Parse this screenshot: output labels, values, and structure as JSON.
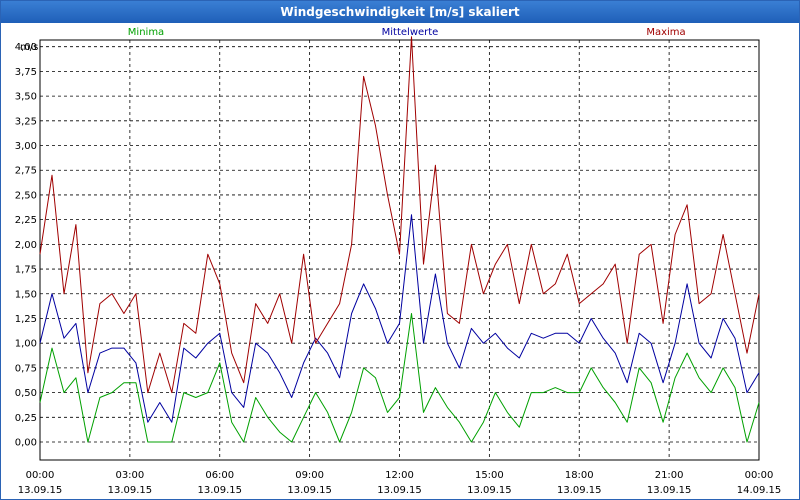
{
  "window": {
    "title": "Windgeschwindigkeit [m/s] skaliert"
  },
  "chart_data": {
    "type": "line",
    "title": "Windgeschwindigkeit [m/s] skaliert",
    "ylabel": "m/s",
    "ylim": [
      0,
      4.25
    ],
    "y_ticks": [
      "0,00",
      "0,25",
      "0,50",
      "0,75",
      "1,00",
      "1,25",
      "1,50",
      "1,75",
      "2,00",
      "2,25",
      "2,50",
      "2,75",
      "3,00",
      "3,25",
      "3,50",
      "3,75",
      "4,00"
    ],
    "x_ticks": [
      {
        "time": "00:00",
        "date": "13.09.15"
      },
      {
        "time": "03:00",
        "date": "13.09.15"
      },
      {
        "time": "06:00",
        "date": "13.09.15"
      },
      {
        "time": "09:00",
        "date": "13.09.15"
      },
      {
        "time": "12:00",
        "date": "13.09.15"
      },
      {
        "time": "15:00",
        "date": "13.09.15"
      },
      {
        "time": "18:00",
        "date": "13.09.15"
      },
      {
        "time": "21:00",
        "date": "13.09.15"
      },
      {
        "time": "00:00",
        "date": "14.09.15"
      }
    ],
    "x_range_hours": [
      0,
      24
    ],
    "grid": true,
    "legend_position": "top",
    "series": [
      {
        "name": "Minima",
        "color": "#00a000",
        "values": [
          [
            0,
            0.4
          ],
          [
            0.4,
            0.95
          ],
          [
            0.8,
            0.5
          ],
          [
            1.2,
            0.65
          ],
          [
            1.6,
            0.0
          ],
          [
            2.0,
            0.45
          ],
          [
            2.4,
            0.5
          ],
          [
            2.8,
            0.6
          ],
          [
            3.2,
            0.6
          ],
          [
            3.6,
            0.0
          ],
          [
            4.0,
            0.0
          ],
          [
            4.4,
            0.0
          ],
          [
            4.8,
            0.5
          ],
          [
            5.2,
            0.45
          ],
          [
            5.6,
            0.5
          ],
          [
            6.0,
            0.8
          ],
          [
            6.4,
            0.2
          ],
          [
            6.8,
            0.0
          ],
          [
            7.2,
            0.45
          ],
          [
            7.6,
            0.25
          ],
          [
            8.0,
            0.1
          ],
          [
            8.4,
            0.0
          ],
          [
            8.8,
            0.25
          ],
          [
            9.2,
            0.5
          ],
          [
            9.6,
            0.3
          ],
          [
            10.0,
            0.0
          ],
          [
            10.4,
            0.3
          ],
          [
            10.8,
            0.75
          ],
          [
            11.2,
            0.65
          ],
          [
            11.6,
            0.3
          ],
          [
            12.0,
            0.45
          ],
          [
            12.4,
            1.3
          ],
          [
            12.8,
            0.3
          ],
          [
            13.2,
            0.55
          ],
          [
            13.6,
            0.35
          ],
          [
            14.0,
            0.2
          ],
          [
            14.4,
            0.0
          ],
          [
            14.8,
            0.2
          ],
          [
            15.2,
            0.5
          ],
          [
            15.6,
            0.3
          ],
          [
            16.0,
            0.15
          ],
          [
            16.4,
            0.5
          ],
          [
            16.8,
            0.5
          ],
          [
            17.2,
            0.55
          ],
          [
            17.6,
            0.5
          ],
          [
            18.0,
            0.5
          ],
          [
            18.4,
            0.75
          ],
          [
            18.8,
            0.55
          ],
          [
            19.2,
            0.4
          ],
          [
            19.6,
            0.2
          ],
          [
            20.0,
            0.75
          ],
          [
            20.4,
            0.6
          ],
          [
            20.8,
            0.2
          ],
          [
            21.2,
            0.65
          ],
          [
            21.6,
            0.9
          ],
          [
            22.0,
            0.65
          ],
          [
            22.4,
            0.5
          ],
          [
            22.8,
            0.75
          ],
          [
            23.2,
            0.55
          ],
          [
            23.6,
            0.0
          ],
          [
            24.0,
            0.4
          ]
        ]
      },
      {
        "name": "Mittelwerte",
        "color": "#0000a0",
        "values": [
          [
            0,
            1.0
          ],
          [
            0.4,
            1.5
          ],
          [
            0.8,
            1.05
          ],
          [
            1.2,
            1.2
          ],
          [
            1.6,
            0.5
          ],
          [
            2.0,
            0.9
          ],
          [
            2.4,
            0.95
          ],
          [
            2.8,
            0.95
          ],
          [
            3.2,
            0.8
          ],
          [
            3.6,
            0.2
          ],
          [
            4.0,
            0.4
          ],
          [
            4.4,
            0.2
          ],
          [
            4.8,
            0.95
          ],
          [
            5.2,
            0.85
          ],
          [
            5.6,
            1.0
          ],
          [
            6.0,
            1.1
          ],
          [
            6.4,
            0.5
          ],
          [
            6.8,
            0.35
          ],
          [
            7.2,
            1.0
          ],
          [
            7.6,
            0.9
          ],
          [
            8.0,
            0.7
          ],
          [
            8.4,
            0.45
          ],
          [
            8.8,
            0.8
          ],
          [
            9.2,
            1.05
          ],
          [
            9.6,
            0.9
          ],
          [
            10.0,
            0.65
          ],
          [
            10.4,
            1.3
          ],
          [
            10.8,
            1.6
          ],
          [
            11.2,
            1.35
          ],
          [
            11.6,
            1.0
          ],
          [
            12.0,
            1.2
          ],
          [
            12.4,
            2.3
          ],
          [
            12.8,
            1.0
          ],
          [
            13.2,
            1.7
          ],
          [
            13.6,
            1.0
          ],
          [
            14.0,
            0.75
          ],
          [
            14.4,
            1.15
          ],
          [
            14.8,
            1.0
          ],
          [
            15.2,
            1.1
          ],
          [
            15.6,
            0.95
          ],
          [
            16.0,
            0.85
          ],
          [
            16.4,
            1.1
          ],
          [
            16.8,
            1.05
          ],
          [
            17.2,
            1.1
          ],
          [
            17.6,
            1.1
          ],
          [
            18.0,
            1.0
          ],
          [
            18.4,
            1.25
          ],
          [
            18.8,
            1.05
          ],
          [
            19.2,
            0.9
          ],
          [
            19.6,
            0.6
          ],
          [
            20.0,
            1.1
          ],
          [
            20.4,
            1.0
          ],
          [
            20.8,
            0.6
          ],
          [
            21.2,
            1.0
          ],
          [
            21.6,
            1.6
          ],
          [
            22.0,
            1.0
          ],
          [
            22.4,
            0.85
          ],
          [
            22.8,
            1.25
          ],
          [
            23.2,
            1.05
          ],
          [
            23.6,
            0.5
          ],
          [
            24.0,
            0.7
          ]
        ]
      },
      {
        "name": "Maxima",
        "color": "#a00000",
        "values": [
          [
            0,
            1.9
          ],
          [
            0.4,
            2.7
          ],
          [
            0.8,
            1.5
          ],
          [
            1.2,
            2.2
          ],
          [
            1.6,
            0.7
          ],
          [
            2.0,
            1.4
          ],
          [
            2.4,
            1.5
          ],
          [
            2.8,
            1.3
          ],
          [
            3.2,
            1.5
          ],
          [
            3.6,
            0.5
          ],
          [
            4.0,
            0.9
          ],
          [
            4.4,
            0.5
          ],
          [
            4.8,
            1.2
          ],
          [
            5.2,
            1.1
          ],
          [
            5.6,
            1.9
          ],
          [
            6.0,
            1.6
          ],
          [
            6.4,
            0.9
          ],
          [
            6.8,
            0.6
          ],
          [
            7.2,
            1.4
          ],
          [
            7.6,
            1.2
          ],
          [
            8.0,
            1.5
          ],
          [
            8.4,
            1.0
          ],
          [
            8.8,
            1.9
          ],
          [
            9.2,
            1.0
          ],
          [
            9.6,
            1.2
          ],
          [
            10.0,
            1.4
          ],
          [
            10.4,
            2.0
          ],
          [
            10.8,
            3.7
          ],
          [
            11.2,
            3.2
          ],
          [
            11.6,
            2.5
          ],
          [
            12.0,
            1.9
          ],
          [
            12.4,
            4.1
          ],
          [
            12.8,
            1.8
          ],
          [
            13.2,
            2.8
          ],
          [
            13.6,
            1.3
          ],
          [
            14.0,
            1.2
          ],
          [
            14.4,
            2.0
          ],
          [
            14.8,
            1.5
          ],
          [
            15.2,
            1.8
          ],
          [
            15.6,
            2.0
          ],
          [
            16.0,
            1.4
          ],
          [
            16.4,
            2.0
          ],
          [
            16.8,
            1.5
          ],
          [
            17.2,
            1.6
          ],
          [
            17.6,
            1.9
          ],
          [
            18.0,
            1.4
          ],
          [
            18.4,
            1.5
          ],
          [
            18.8,
            1.6
          ],
          [
            19.2,
            1.8
          ],
          [
            19.6,
            1.0
          ],
          [
            20.0,
            1.9
          ],
          [
            20.4,
            2.0
          ],
          [
            20.8,
            1.2
          ],
          [
            21.2,
            2.1
          ],
          [
            21.6,
            2.4
          ],
          [
            22.0,
            1.4
          ],
          [
            22.4,
            1.5
          ],
          [
            22.8,
            2.1
          ],
          [
            23.2,
            1.5
          ],
          [
            23.6,
            0.9
          ],
          [
            24.0,
            1.5
          ]
        ]
      }
    ]
  }
}
